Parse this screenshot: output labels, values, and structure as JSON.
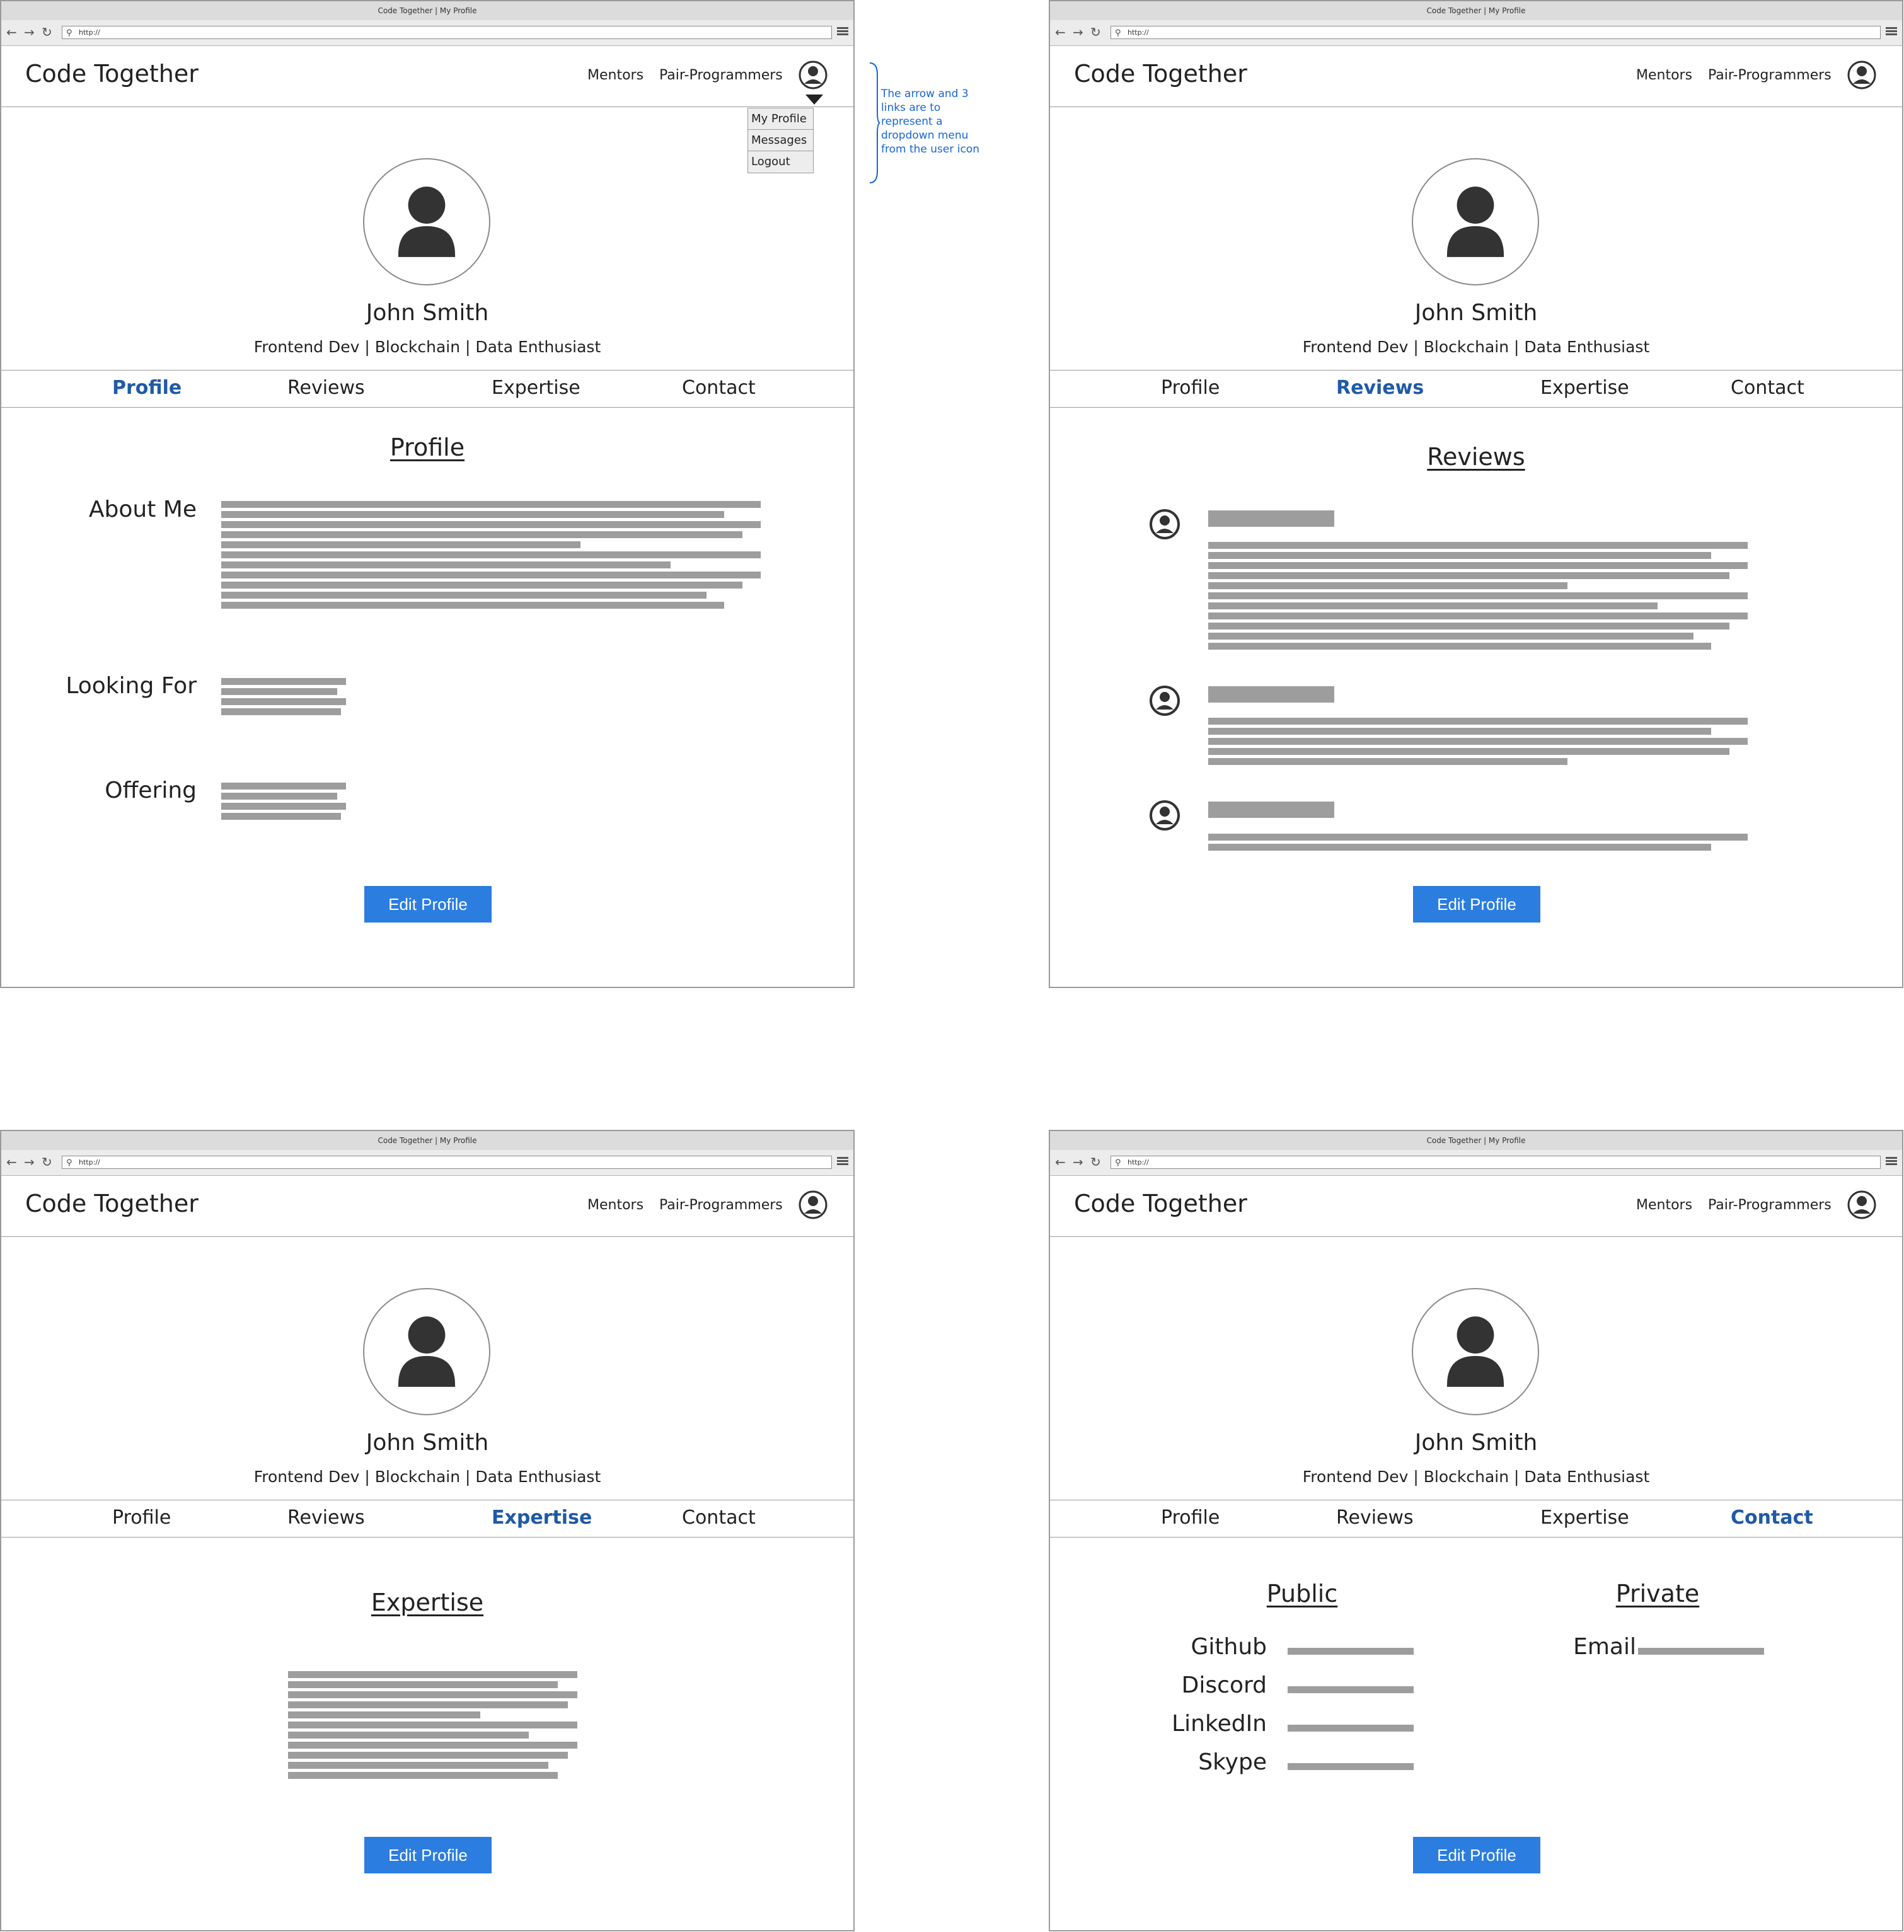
{
  "browser": {
    "window_title": "Code Together | My Profile",
    "address": "http://"
  },
  "app": {
    "brand": "Code Together",
    "nav_mentors": "Mentors",
    "nav_pair": "Pair-Programmers"
  },
  "profile": {
    "name": "John Smith",
    "tagline": "Frontend Dev | Blockchain | Data Enthusiast"
  },
  "tabs": [
    "Profile",
    "Reviews",
    "Expertise",
    "Contact"
  ],
  "dropdown": [
    "My Profile",
    "Messages",
    "Logout"
  ],
  "annotation": "The arrow and 3 links are to represent a dropdown menu from the user icon",
  "screens": {
    "profile": {
      "title": "Profile",
      "about_label": "About Me",
      "looking_label": "Looking For",
      "offering_label": "Offering"
    },
    "reviews": {
      "title": "Reviews"
    },
    "expertise": {
      "title": "Expertise"
    },
    "contact": {
      "public_title": "Public",
      "private_title": "Private",
      "github": "Github",
      "discord": "Discord",
      "linkedin": "LinkedIn",
      "skype": "Skype",
      "email": "Email"
    }
  },
  "edit_button": "Edit Profile",
  "icons": {
    "back": "arrow-left-icon",
    "forward": "arrow-right-icon",
    "reload": "reload-icon",
    "search": "search-icon",
    "menu": "hamburger-menu-icon",
    "user": "user-circle-icon",
    "avatar": "person-silhouette-icon"
  },
  "colors": {
    "accent": "#2b7de0",
    "active_tab": "#1f5aa6",
    "placeholder_bar": "#9d9d9d",
    "annotation": "#1565d8"
  }
}
